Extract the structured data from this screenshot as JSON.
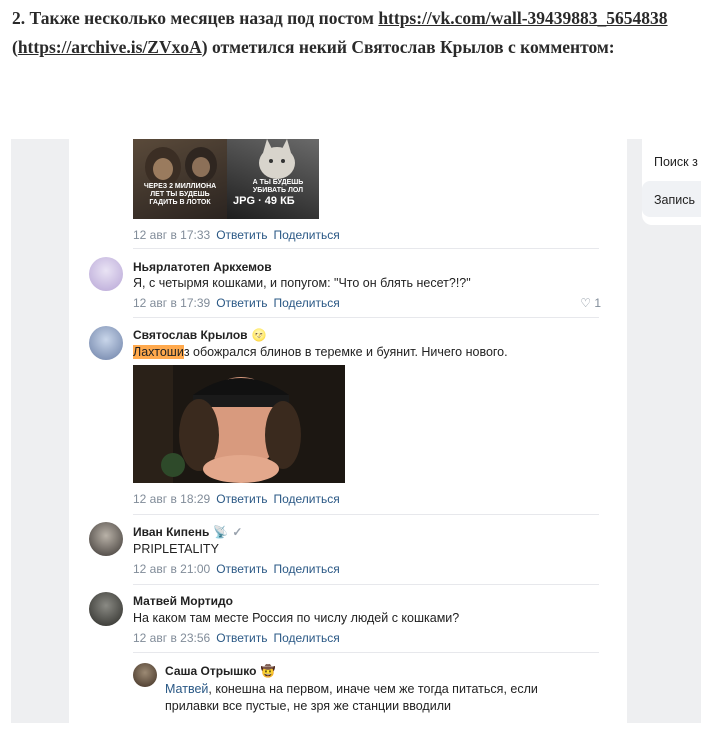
{
  "intro": {
    "prefix": "2. Также несколько месяцев назад под постом ",
    "link1": "https://vk.com/wall-39439883_5654838",
    "mid": " (",
    "link2": "https://archive.is/ZVxoA",
    "suffix": ") отметился некий Святослав Крылов с комментом:"
  },
  "right_panel": {
    "item1": "Поиск з",
    "item2": "Запись"
  },
  "post": {
    "meme_left": "ЧЕРЕЗ 2 МИЛЛИОНА ЛЕТ ТЫ БУДЕШЬ ГАДИТЬ В ЛОТОК",
    "meme_right": "А ТЫ БУДЕШЬ УБИВАТЬ ЛОЛ",
    "badge": "JPG · 49 КБ",
    "time": "12 авг в 17:33",
    "reply": "Ответить",
    "share": "Поделиться"
  },
  "comments": [
    {
      "author": "Ньярлатотеп Аркхемов",
      "text": "Я, с четырмя кошками, и попугом: \"Что он блять несет?!?\"",
      "time": "12 авг в 17:39",
      "reply": "Ответить",
      "share": "Поделиться",
      "likes": "1"
    },
    {
      "author": "Святослав Крылов",
      "emoji": "🌝",
      "highlight": "Лахтоши",
      "text": "з обожрался блинов в теремке и буянит. Ничего нового.",
      "time": "12 авг в 18:29",
      "reply": "Ответить",
      "share": "Поделиться"
    },
    {
      "author": "Иван Кипень",
      "emoji": "📡",
      "check": "✓",
      "text": "PRIPLETALITY",
      "time": "12 авг в 21:00",
      "reply": "Ответить",
      "share": "Поделиться"
    },
    {
      "author": "Матвей Мортидо",
      "text": "На каком там месте Россия по числу людей с кошками?",
      "time": "12 авг в 23:56",
      "reply": "Ответить",
      "share": "Поделиться"
    },
    {
      "author": "Саша Отрышко",
      "emoji": "🤠",
      "mention": "Матвей",
      "text_line1": ", конешна на первом, иначе чем же тогда питаться, если",
      "text_line2": "прилавки все пустые, не зря же станции вводили"
    }
  ],
  "colors": {
    "link": "#2a5885",
    "meta": "#818c99",
    "highlight": "#ffa94d",
    "bg": "#eeeff1"
  }
}
